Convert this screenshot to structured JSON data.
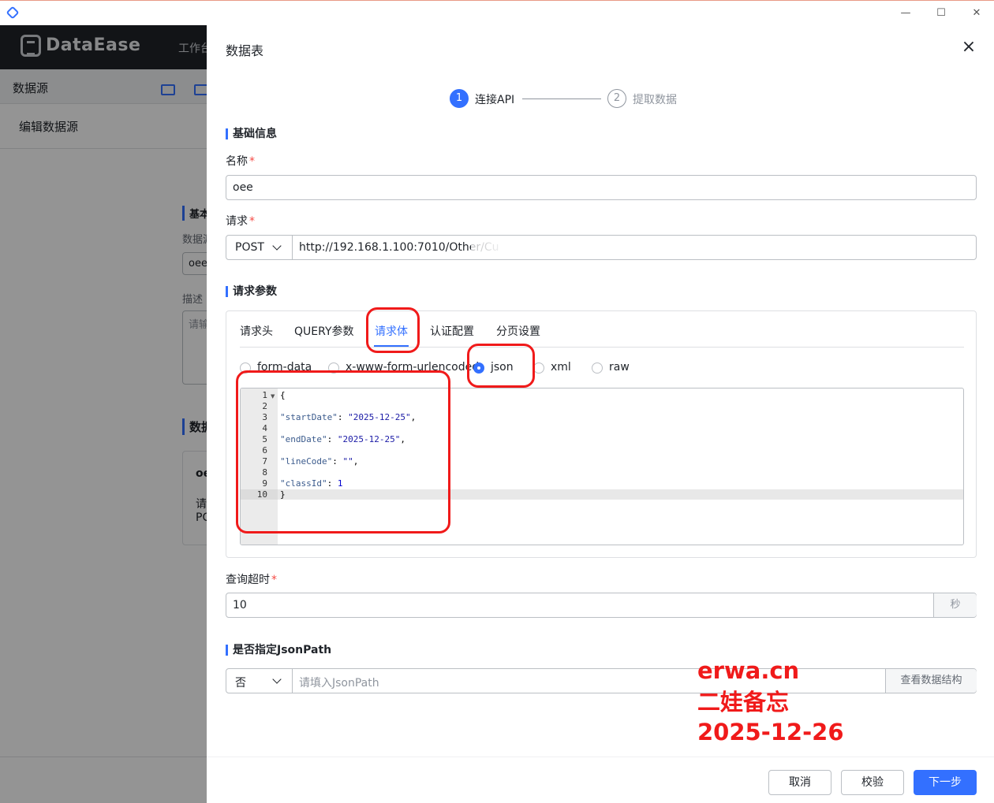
{
  "window": {
    "minimize": "—",
    "maximize": "☐",
    "close": "✕"
  },
  "bg": {
    "logo": "DataEase",
    "workbench": "工作台",
    "sidebar_title": "数据源",
    "edit_title": "编辑数据源",
    "section_basic": "基本",
    "label_name": "数据源",
    "name_value": "oee",
    "label_desc": "描述",
    "desc_placeholder": "请输",
    "section_table": "数据",
    "card_title": "oe",
    "card_line1": "请",
    "card_line2": "PC"
  },
  "drawer": {
    "title": "数据表",
    "steps": [
      {
        "num": "1",
        "label": "连接API"
      },
      {
        "num": "2",
        "label": "提取数据"
      }
    ],
    "section_basic": "基础信息",
    "name_label": "名称",
    "name_value": "oee",
    "request_label": "请求",
    "method": "POST",
    "url": "http://192.168.1.100:7010/Other/Cu",
    "section_params": "请求参数",
    "tabs": [
      "请求头",
      "QUERY参数",
      "请求体",
      "认证配置",
      "分页设置"
    ],
    "radios": [
      "form-data",
      "x-www-form-urlencoded",
      "json",
      "xml",
      "raw"
    ],
    "code": {
      "line_numbers": [
        "1",
        "2",
        "3",
        "4",
        "5",
        "6",
        "7",
        "8",
        "9",
        "10"
      ],
      "open": "{",
      "close": "}",
      "k1": "\"startDate\"",
      "v1": "\"2025-12-25\"",
      "k2": "\"endDate\"",
      "v2": "\"2025-12-25\"",
      "k3": "\"lineCode\"",
      "v3": "\"\"",
      "k4": "\"classId\"",
      "v4": "1"
    },
    "timeout_label": "查询超时",
    "timeout_value": "10",
    "timeout_unit": "秒",
    "section_jsonpath": "是否指定JsonPath",
    "jsonpath_select": "否",
    "jsonpath_placeholder": "请填入JsonPath",
    "view_structure": "查看数据结构",
    "buttons": {
      "cancel": "取消",
      "validate": "校验",
      "next": "下一步"
    }
  },
  "watermark": {
    "line1": "erwa.cn",
    "line2": "二娃备忘",
    "line3": "2025-12-26"
  },
  "colors": {
    "accent": "#3370ff",
    "annotation": "#f01a1a"
  }
}
